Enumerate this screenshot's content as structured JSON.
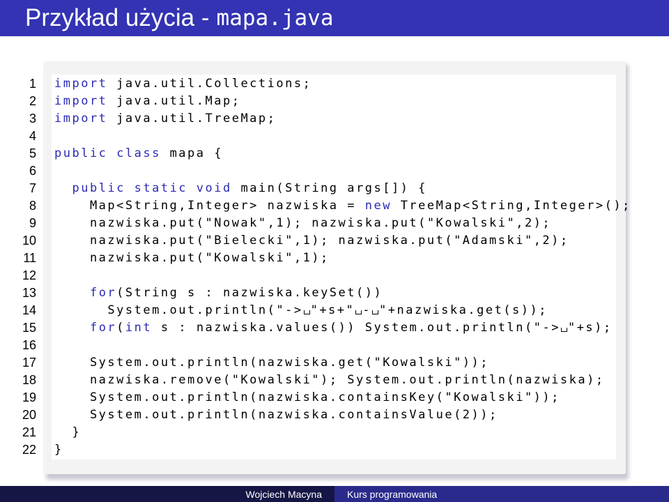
{
  "slide": {
    "title_text": "Przykład użycia - ",
    "title_mono": "mapa.java"
  },
  "line_numbers": [
    "1",
    "2",
    "3",
    "4",
    "5",
    "6",
    "7",
    "8",
    "9",
    "10",
    "11",
    "12",
    "13",
    "14",
    "15",
    "16",
    "17",
    "18",
    "19",
    "20",
    "21",
    "22"
  ],
  "code_lines": [
    [
      {
        "t": "import",
        "k": true
      },
      {
        "t": " java.util.Collections;"
      }
    ],
    [
      {
        "t": "import",
        "k": true
      },
      {
        "t": " java.util.Map;"
      }
    ],
    [
      {
        "t": "import",
        "k": true
      },
      {
        "t": " java.util.TreeMap;"
      }
    ],
    [],
    [
      {
        "t": "public class",
        "k": true
      },
      {
        "t": " mapa {"
      }
    ],
    [],
    [
      {
        "t": "  "
      },
      {
        "t": "public static void",
        "k": true
      },
      {
        "t": " main(String args[]) {"
      }
    ],
    [
      {
        "t": "    Map<String,Integer> nazwiska = "
      },
      {
        "t": "new",
        "k": true
      },
      {
        "t": " TreeMap<String,Integer>();"
      }
    ],
    [
      {
        "t": "    nazwiska.put(\"Nowak\",1); nazwiska.put(\"Kowalski\",2);"
      }
    ],
    [
      {
        "t": "    nazwiska.put(\"Bielecki\",1); nazwiska.put(\"Adamski\",2);"
      }
    ],
    [
      {
        "t": "    nazwiska.put(\"Kowalski\",1);"
      }
    ],
    [],
    [
      {
        "t": "    "
      },
      {
        "t": "for",
        "k": true
      },
      {
        "t": "(String s : nazwiska.keySet())"
      }
    ],
    [
      {
        "t": "      System.out.println(\"->"
      },
      {
        "s": true
      },
      {
        "t": "\"+s+\""
      },
      {
        "s": true
      },
      {
        "t": "-"
      },
      {
        "s": true
      },
      {
        "t": "\"+nazwiska.get(s));"
      }
    ],
    [
      {
        "t": "    "
      },
      {
        "t": "for",
        "k": true
      },
      {
        "t": "("
      },
      {
        "t": "int",
        "k": true
      },
      {
        "t": " s : nazwiska.values()) System.out.println(\"->"
      },
      {
        "s": true
      },
      {
        "t": "\"+s);"
      }
    ],
    [],
    [
      {
        "t": "    System.out.println(nazwiska.get(\"Kowalski\"));"
      }
    ],
    [
      {
        "t": "    nazwiska.remove(\"Kowalski\"); System.out.println(nazwiska);"
      }
    ],
    [
      {
        "t": "    System.out.println(nazwiska.containsKey(\"Kowalski\"));"
      }
    ],
    [
      {
        "t": "    System.out.println(nazwiska.containsValue(2));"
      }
    ],
    [
      {
        "t": "  }"
      }
    ],
    [
      {
        "t": "}"
      }
    ]
  ],
  "footer": {
    "author": "Wojciech Macyna",
    "course": "Kurs programowania"
  },
  "colors": {
    "title_bar": "#3333b3",
    "keyword": "#2b2bb3",
    "footer_left": "#161646",
    "footer_right": "#2a2a8c"
  }
}
